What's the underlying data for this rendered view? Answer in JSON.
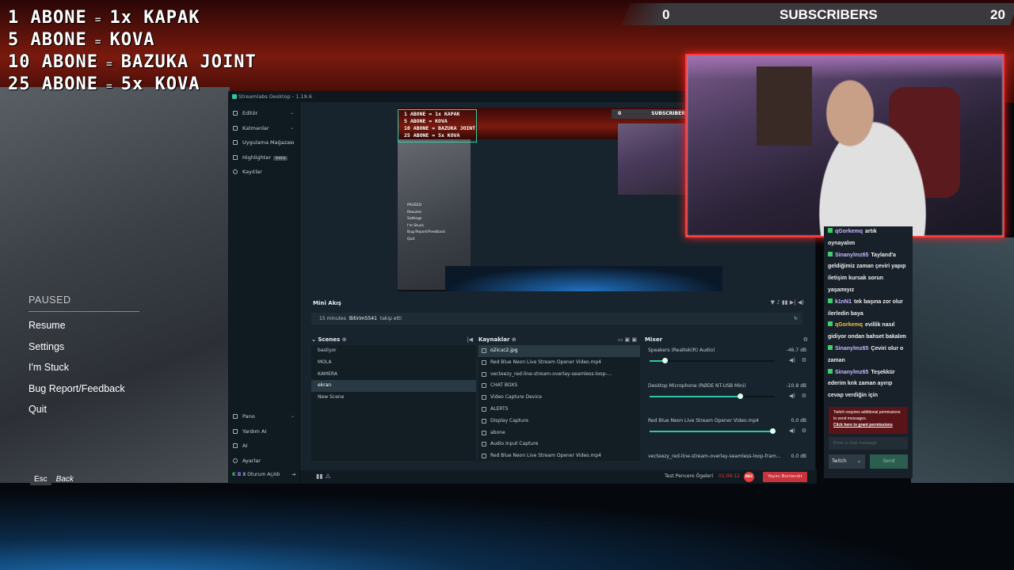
{
  "overlay": {
    "goals": [
      {
        "count": "1 ABONE",
        "reward": "1x KAPAK"
      },
      {
        "count": "5 ABONE",
        "reward": "KOVA"
      },
      {
        "count": "10 ABONE",
        "reward": "BAZUKA JOINT"
      },
      {
        "count": "25 ABONE",
        "reward": "5x KOVA"
      }
    ],
    "eq_symbol": "=",
    "subscribers": {
      "current": "0",
      "label": "SUBSCRIBERS",
      "target": "20"
    }
  },
  "pause_menu": {
    "title": "PAUSED",
    "items": [
      "Resume",
      "Settings",
      "I'm Stuck",
      "Bug Report/Feedback",
      "Quit"
    ],
    "hint_key": "Esc",
    "hint_label": "Back"
  },
  "streamlabs": {
    "title": "Streamlabs Desktop - 1.19.6",
    "sidebar": [
      {
        "label": "Editör",
        "chevron": "⌄"
      },
      {
        "label": "Katmanlar",
        "chevron": "⌄"
      },
      {
        "label": "Uygulama Mağazası",
        "chevron": "⌄"
      },
      {
        "label": "Highlighter",
        "badge": "beta"
      },
      {
        "label": "Kayıtlar"
      }
    ],
    "sidebar_bottom": [
      {
        "label": "Pano",
        "chevron": "⌄"
      },
      {
        "label": "Yardım AI"
      },
      {
        "label": "AI"
      },
      {
        "label": "Ayarlar"
      }
    ],
    "login": "Oturum Açıldı",
    "mini_feed": {
      "title": "Mini Akış",
      "time": "15 minutes",
      "user": "Bitirim5541",
      "action": "takip etti"
    },
    "scenes": {
      "title": "Scenes",
      "items": [
        "basliyor",
        "MOLA",
        "KAMERA",
        "ekran",
        "New Scene"
      ],
      "selected": 3
    },
    "sources": {
      "title": "Kaynaklar",
      "items": [
        "o2icuc2.jpg",
        "Red Blue Neon Live Stream Opener Video.mp4",
        "vecteezy_red-line-stream-overlay-seamless-loop-...",
        "CHAT BOXS",
        "Video Capture Device",
        "ALERTS",
        "Display Capture",
        "abone",
        "Audio Input Capture",
        "Red Blue Neon Live Stream Opener Video.mp4"
      ],
      "selected": 0
    },
    "mixer": {
      "title": "Mixer",
      "channels": [
        {
          "name": "Speakers (Realtek(R) Audio)",
          "db": "-46.7 dB",
          "level": 0.12
        },
        {
          "name": "Desktop Microphone (RØDE NT-USB Mini)",
          "db": "-10.8 dB",
          "level": 0.72
        },
        {
          "name": "Red Blue Neon Live Stream Opener Video.mp4",
          "db": "0.0 dB",
          "level": 0.98
        },
        {
          "name": "vecteezy_red-line-stream-overlay-seamless-loop-fram...",
          "db": "0.0 dB",
          "level": 0.98
        }
      ]
    },
    "status": {
      "test": "Test Pencere Ögeleri",
      "time": "01:09:12",
      "rec": "REC",
      "live": "Yayını Bonlandır"
    },
    "preview": {
      "goals": [
        "1 ABONE = 1x KAPAK",
        "5 ABONE = KOVA",
        "10 ABONE = BAZUKA JOINT",
        "25 ABONE = 5x KOVA"
      ],
      "sub_current": "0",
      "sub_label": "SUBSCRIBERS",
      "menu": [
        "PAUSED",
        "Resume",
        "Settings",
        "I'm Stuck",
        "Bug Report/Feedback",
        "Quit"
      ]
    }
  },
  "chat": {
    "messages": [
      {
        "user": "qGorkemq",
        "text": "artık",
        "color": "#c8b7ff"
      },
      {
        "user": "",
        "text": "oynayalım",
        "color": ""
      },
      {
        "user": "Sinanylmz65",
        "text": "Tayland'a",
        "color": "#c8b7ff"
      },
      {
        "user": "",
        "text": "geldiğimiz zaman çeviri yapıp",
        "color": ""
      },
      {
        "user": "",
        "text": "iletişim kursak sorun",
        "color": ""
      },
      {
        "user": "",
        "text": "yaşamıyız",
        "color": ""
      },
      {
        "user": "k1nN1",
        "text": "tek başına zor olur",
        "color": "#c8b7ff"
      },
      {
        "user": "",
        "text": "ilerledin baya",
        "color": ""
      },
      {
        "user": "qGorkemq",
        "text": "evillik nasıl",
        "color": "#f0c040"
      },
      {
        "user": "",
        "text": "gidiyor ondan bahset bakalım",
        "color": ""
      },
      {
        "user": "Sinanylmz65",
        "text": "Çeviri olur o",
        "color": "#c8b7ff"
      },
      {
        "user": "",
        "text": "zaman",
        "color": ""
      },
      {
        "user": "Sinanylmz65",
        "text": "Teşekkür",
        "color": "#c8b7ff"
      },
      {
        "user": "",
        "text": "ederim knk zaman ayırıp",
        "color": ""
      },
      {
        "user": "",
        "text": "cevap verdiğin için",
        "color": ""
      }
    ],
    "warning": "Twitch requires additional permissions to send messages.",
    "warning_link": "Click here to grant permissions",
    "input_placeholder": "Enter a chat message",
    "platform": "Twitch",
    "send": "Send"
  },
  "colors": {
    "accent": "#31c3a2",
    "live": "#c8323a",
    "cam_border": "#ff3b3b"
  }
}
